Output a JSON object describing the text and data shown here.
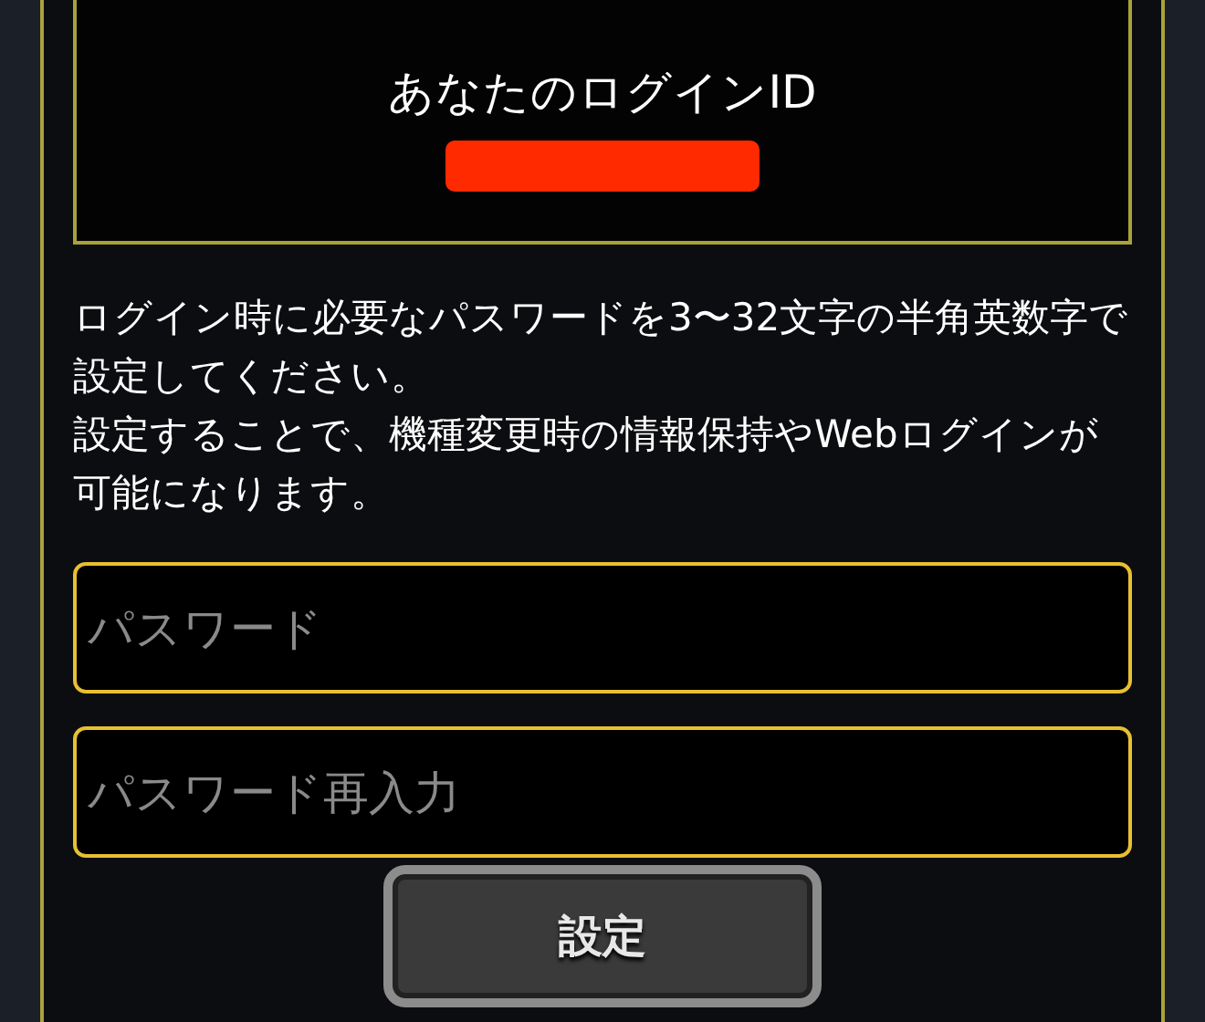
{
  "id_panel": {
    "title": "あなたのログインID"
  },
  "description": [
    "ログイン時に必要なパスワードを3〜32文字の半角英数字で設定してください。",
    "設定することで、機種変更時の情報保持やWebログインが可能になります。"
  ],
  "fields": [
    {
      "placeholder": "パスワード"
    },
    {
      "placeholder": "パスワード再入力"
    }
  ],
  "submit_button": {
    "label": "設定"
  }
}
